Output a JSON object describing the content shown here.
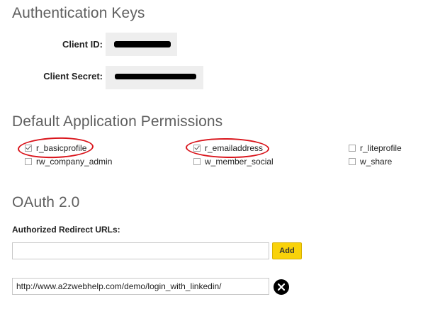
{
  "auth": {
    "heading": "Authentication Keys",
    "client_id_label": "Client ID:",
    "client_secret_label": "Client Secret:"
  },
  "permissions": {
    "heading": "Default Application Permissions",
    "items": [
      {
        "label": "r_basicprofile",
        "checked": true,
        "highlighted": true
      },
      {
        "label": "r_emailaddress",
        "checked": true,
        "highlighted": true
      },
      {
        "label": "r_liteprofile",
        "checked": false,
        "highlighted": false
      },
      {
        "label": "rw_company_admin",
        "checked": false,
        "highlighted": false
      },
      {
        "label": "w_member_social",
        "checked": false,
        "highlighted": false
      },
      {
        "label": "w_share",
        "checked": false,
        "highlighted": false
      }
    ]
  },
  "oauth": {
    "heading": "OAuth 2.0",
    "redirect_label": "Authorized Redirect URLs:",
    "redirect_input_value": "",
    "add_label": "Add",
    "urls": [
      "http://www.a2zwebhelp.com/demo/login_with_linkedin/"
    ],
    "remove_icon": "close-circle-icon"
  },
  "colors": {
    "heading": "#5f5f5f",
    "add_button": "#f9d20a",
    "highlight_circle": "#d9141b",
    "key_box": "#eeeeee"
  }
}
